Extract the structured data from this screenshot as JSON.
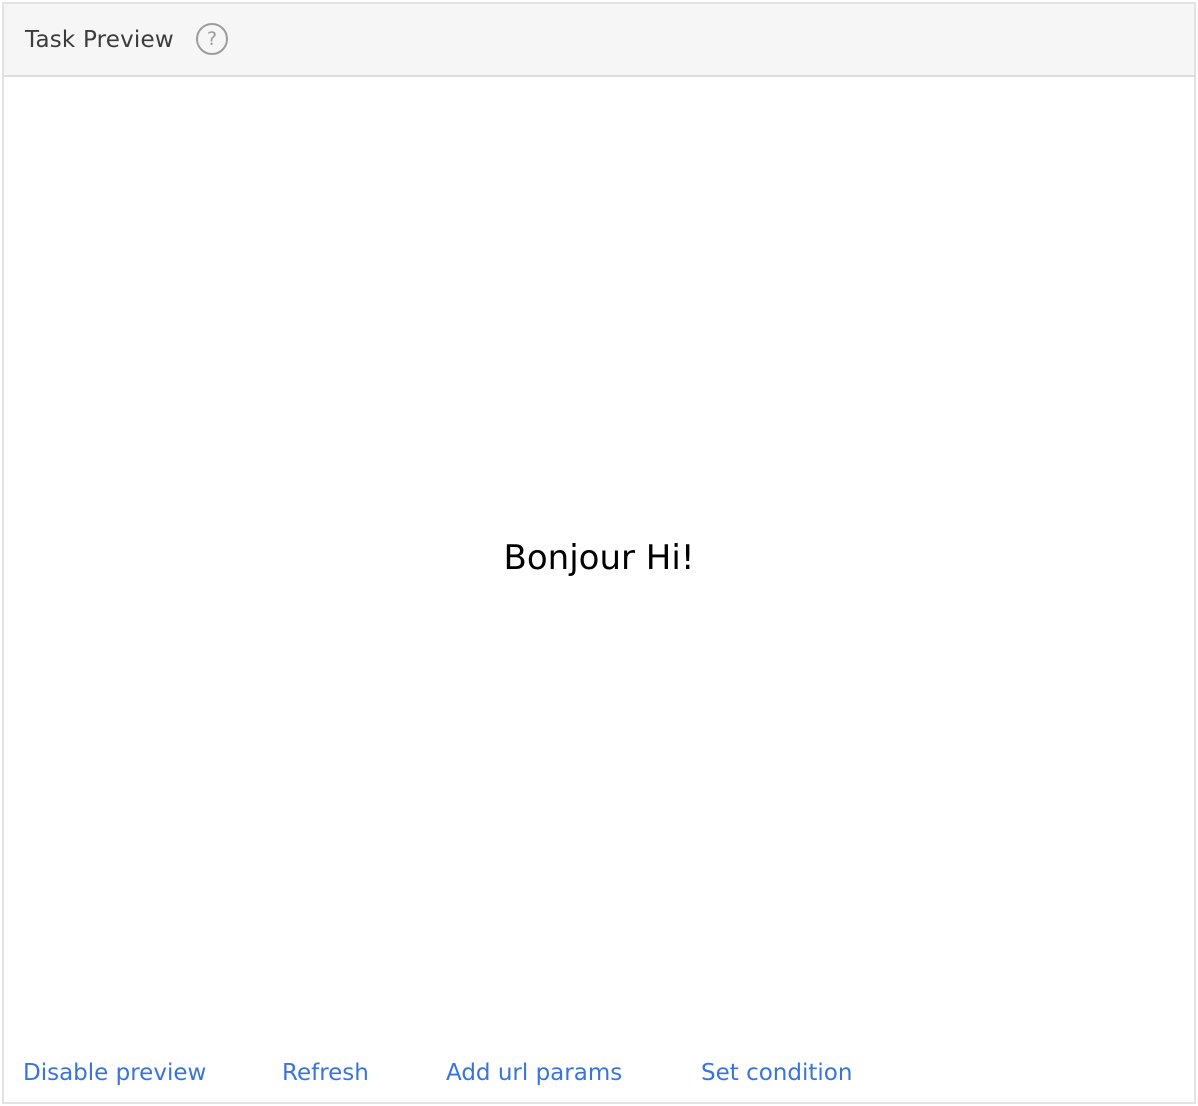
{
  "header": {
    "title": "Task Preview",
    "help_icon_glyph": "?",
    "help_icon_name": "question-circle-icon"
  },
  "preview": {
    "text": "Bonjour Hi!"
  },
  "footer": {
    "links": [
      "Disable preview",
      "Refresh",
      "Add url params",
      "Set condition"
    ]
  },
  "colors": {
    "link": "#3b74d9",
    "header_bg": "#f6f6f6",
    "border": "#e2e2e2"
  }
}
